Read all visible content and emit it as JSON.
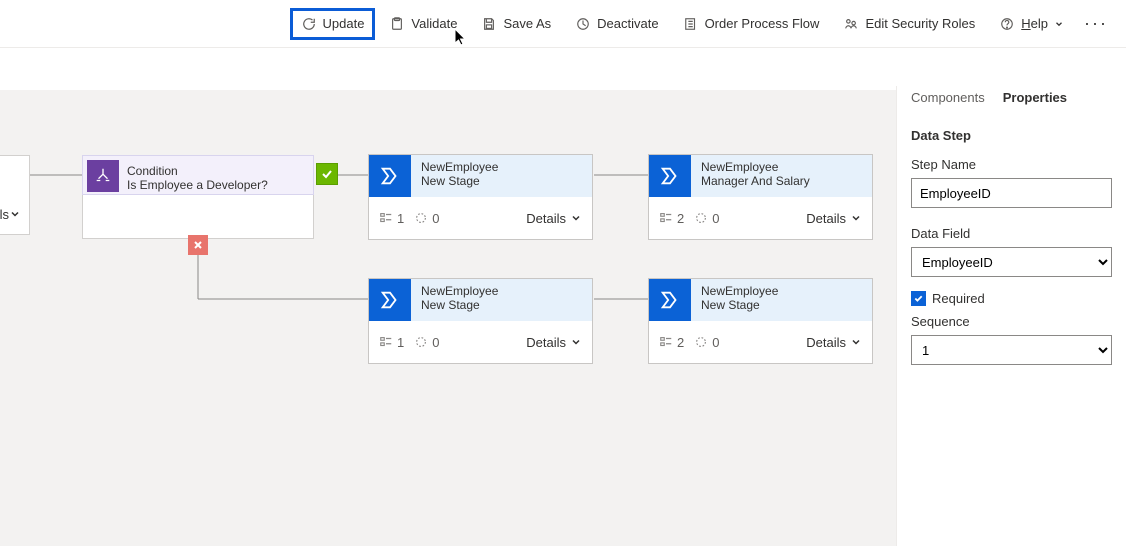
{
  "toolbar": {
    "update": "Update",
    "validate": "Validate",
    "saveAs": "Save As",
    "deactivate": "Deactivate",
    "orderFlow": "Order Process Flow",
    "editSecurity": "Edit Security Roles",
    "helpPrefix": "H",
    "helpSuffix": "elp"
  },
  "condition": {
    "title": "Condition",
    "subtitle": "Is Employee a Developer?"
  },
  "leftStage": {
    "badgeLabel": "ls"
  },
  "stages": [
    {
      "entity": "NewEmployee",
      "stage": "New Stage",
      "steps": "1",
      "cycles": "0"
    },
    {
      "entity": "NewEmployee",
      "stage": "Manager And Salary",
      "steps": "2",
      "cycles": "0"
    },
    {
      "entity": "NewEmployee",
      "stage": "New Stage",
      "steps": "1",
      "cycles": "0"
    },
    {
      "entity": "NewEmployee",
      "stage": "New Stage",
      "steps": "2",
      "cycles": "0"
    }
  ],
  "detailsLabel": "Details",
  "panel": {
    "tabs": {
      "components": "Components",
      "properties": "Properties"
    },
    "sectionTitle": "Data Step",
    "stepNameLabel": "Step Name",
    "stepNameValue": "EmployeeID",
    "dataFieldLabel": "Data Field",
    "dataFieldValue": "EmployeeID",
    "requiredLabel": "Required",
    "sequenceLabel": "Sequence",
    "sequenceValue": "1"
  }
}
